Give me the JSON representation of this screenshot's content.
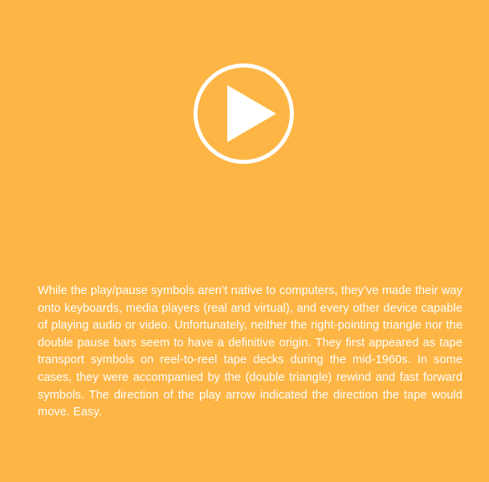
{
  "colors": {
    "background": "#FDB646",
    "foreground": "#FFFFFF"
  },
  "player": {
    "icon": "play-circle-icon"
  },
  "article": {
    "text": "While the play/pause symbols aren’t native to computers, they’ve made their way onto keyboards, media players (real and virtual), and every other device capable of playing audio or video. Unfortunately, neither the right-pointing triangle nor the double pause bars seem to have a definitive origin. They first appeared as tape transport symbols on reel-to-reel tape decks during the mid-1960s. In some cases, they were accompanied by the (double triangle) rewind and fast forward symbols. The direction of the play arrow indicated the direction the tape would move. Easy."
  }
}
